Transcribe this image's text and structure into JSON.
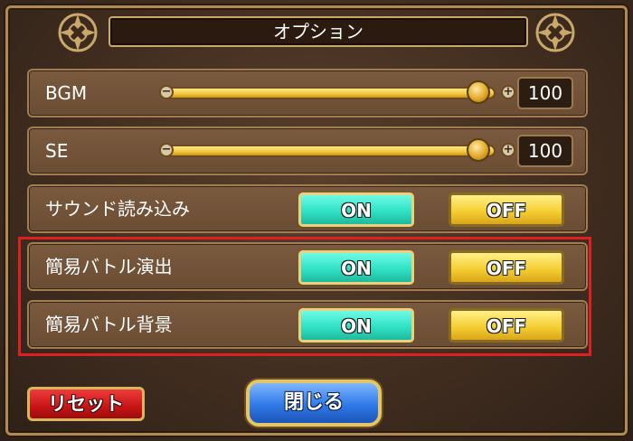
{
  "title": "オプション",
  "bgm": {
    "label": "BGM",
    "value": "100",
    "level": 1.0
  },
  "se": {
    "label": "SE",
    "value": "100",
    "level": 1.0
  },
  "toggles": [
    {
      "label": "サウンド読み込み",
      "on_label": "ON",
      "off_label": "OFF"
    },
    {
      "label": "簡易バトル演出",
      "on_label": "ON",
      "off_label": "OFF"
    },
    {
      "label": "簡易バトル背景",
      "on_label": "ON",
      "off_label": "OFF"
    }
  ],
  "footer": {
    "reset_label": "リセット",
    "close_label": "閉じる"
  },
  "colors": {
    "on_button": "#2fe2c5",
    "off_button": "#f5cf34",
    "reset_button": "#c81414",
    "close_button": "#2f7ae6",
    "highlight": "#e02020"
  }
}
